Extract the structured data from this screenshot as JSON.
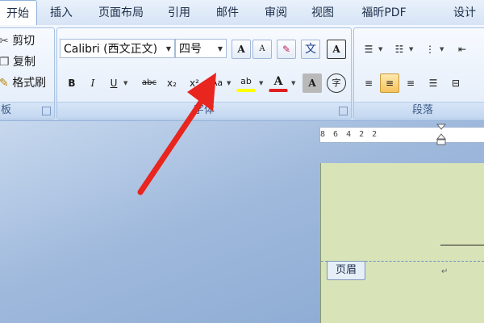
{
  "tabs": [
    {
      "label": "开始",
      "active": true
    },
    {
      "label": "插入"
    },
    {
      "label": "页面布局"
    },
    {
      "label": "引用"
    },
    {
      "label": "邮件"
    },
    {
      "label": "审阅"
    },
    {
      "label": "视图"
    },
    {
      "label": "福昕PDF"
    },
    {
      "label": "设计"
    }
  ],
  "clipboard": {
    "cut_label": "剪切",
    "copy_label": "复制",
    "format_painter_label": "格式刷",
    "group_label_partial": "板"
  },
  "font": {
    "font_name": "Calibri (西文正文)",
    "font_size": "四号",
    "group_label": "字体",
    "bold": "B",
    "italic": "I",
    "underline": "U",
    "strikethrough": "abc",
    "subscript": "x₂",
    "superscript": "x²",
    "change_case": "Aa",
    "grow_font": "A",
    "shrink_font": "A",
    "clear_format_glyph": "✎",
    "phonetic_guide": "文",
    "char_border": "A",
    "highlight": "ab",
    "font_color": "A",
    "char_shading": "A",
    "enclose": "字"
  },
  "paragraph": {
    "group_label": "段落"
  },
  "document": {
    "header_tag": "页眉",
    "paragraph_mark": "↵",
    "ruler_text": "8  6  4  2     2"
  },
  "colors": {
    "accent": "#2b579a",
    "highlight": "#ffff00",
    "font_color": "#e02020",
    "arrow": "#e8251e",
    "page": "#d8e4b8"
  }
}
